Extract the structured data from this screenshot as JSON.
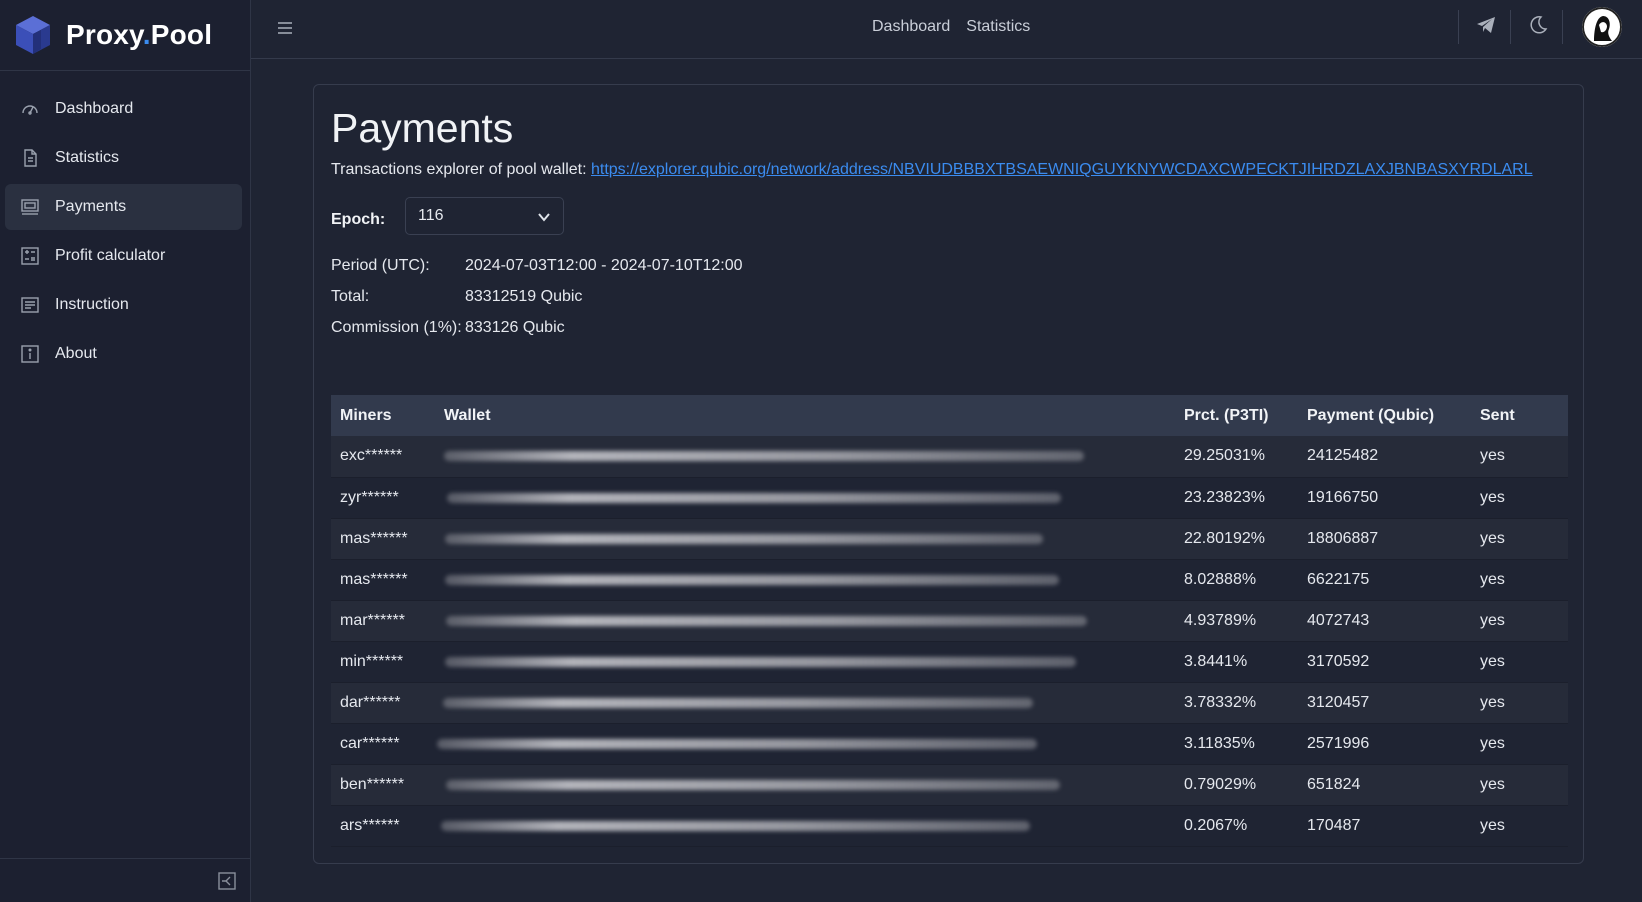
{
  "brand": {
    "name_part1": "Proxy",
    "name_dot": ".",
    "name_part2": "Pool"
  },
  "sidebar": {
    "items": [
      {
        "label": "Dashboard",
        "icon": "speedometer-icon"
      },
      {
        "label": "Statistics",
        "icon": "document-icon"
      },
      {
        "label": "Payments",
        "icon": "cash-icon",
        "active": true
      },
      {
        "label": "Profit calculator",
        "icon": "calculator-icon"
      },
      {
        "label": "Instruction",
        "icon": "list-icon"
      },
      {
        "label": "About",
        "icon": "info-icon"
      }
    ]
  },
  "topbar": {
    "links": [
      "Dashboard",
      "Statistics"
    ]
  },
  "main": {
    "title": "Payments",
    "explorer_label": "Transactions explorer of pool wallet: ",
    "explorer_url": "https://explorer.qubic.org/network/address/NBVIUDBBBXTBSAEWNIQGUYKNYWCDAXCWPECKTJIHRDZLAXJBNBASXYRDLARL",
    "epoch_label": "Epoch:",
    "epoch_value": "116",
    "period_label": "Period (UTC):",
    "period_value": "2024-07-03T12:00 - 2024-07-10T12:00",
    "total_label": "Total:",
    "total_value": "83312519 Qubic",
    "commission_label": "Commission (1%):",
    "commission_value": "833126 Qubic"
  },
  "table": {
    "headers": [
      "Miners",
      "Wallet",
      "Prct. (P3TI)",
      "Payment (Qubic)",
      "Sent"
    ],
    "rows": [
      {
        "miner": "exc******",
        "prct": "29.25031%",
        "payment": "24125482",
        "sent": "yes"
      },
      {
        "miner": "zyr******",
        "prct": "23.23823%",
        "payment": "19166750",
        "sent": "yes"
      },
      {
        "miner": "mas******",
        "prct": "22.80192%",
        "payment": "18806887",
        "sent": "yes"
      },
      {
        "miner": "mas******",
        "prct": "8.02888%",
        "payment": "6622175",
        "sent": "yes"
      },
      {
        "miner": "mar******",
        "prct": "4.93789%",
        "payment": "4072743",
        "sent": "yes"
      },
      {
        "miner": "min******",
        "prct": "3.8441%",
        "payment": "3170592",
        "sent": "yes"
      },
      {
        "miner": "dar******",
        "prct": "3.78332%",
        "payment": "3120457",
        "sent": "yes"
      },
      {
        "miner": "car******",
        "prct": "3.11835%",
        "payment": "2571996",
        "sent": "yes"
      },
      {
        "miner": "ben******",
        "prct": "0.79029%",
        "payment": "651824",
        "sent": "yes"
      },
      {
        "miner": "ars******",
        "prct": "0.2067%",
        "payment": "170487",
        "sent": "yes"
      }
    ]
  },
  "colors": {
    "accent": "#3b8cf0",
    "background": "#1f2433",
    "sidebar": "#1c2030"
  }
}
